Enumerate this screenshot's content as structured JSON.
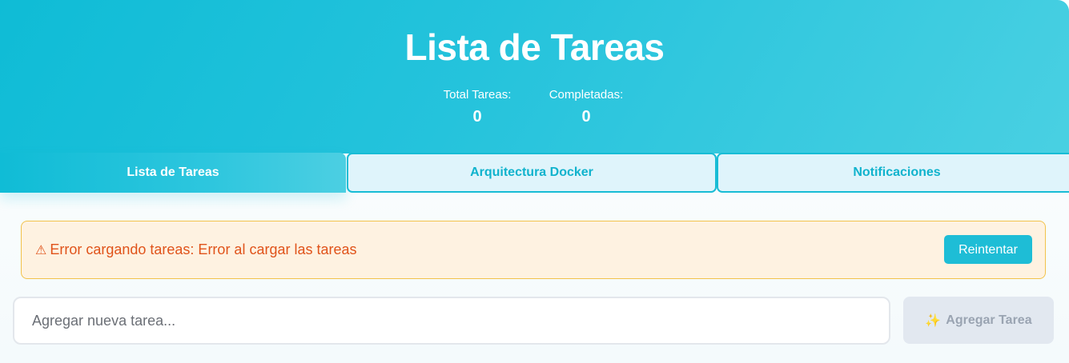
{
  "header": {
    "title": "Lista de Tareas",
    "stats": [
      {
        "label": "Total Tareas:",
        "value": "0"
      },
      {
        "label": "Completadas:",
        "value": "0"
      }
    ]
  },
  "tabs": [
    {
      "label": "Lista de Tareas",
      "active": true
    },
    {
      "label": "Arquitectura Docker",
      "active": false
    },
    {
      "label": "Notificaciones",
      "active": false
    }
  ],
  "error": {
    "icon": "warning-icon",
    "icon_glyph": "⚠",
    "message": "Error cargando tareas: Error al cargar las tareas",
    "retry_label": "Reintentar"
  },
  "new_task": {
    "placeholder": "Agregar nueva tarea...",
    "value": "",
    "add_icon": "sparkles-icon",
    "add_icon_glyph": "✨",
    "add_label": "Agregar Tarea"
  },
  "colors": {
    "primary": "#10bcd6",
    "error_text": "#e0531a",
    "error_bg": "#fef2e1",
    "error_border": "#f2c24b",
    "disabled_bg": "#e2e8f0"
  }
}
